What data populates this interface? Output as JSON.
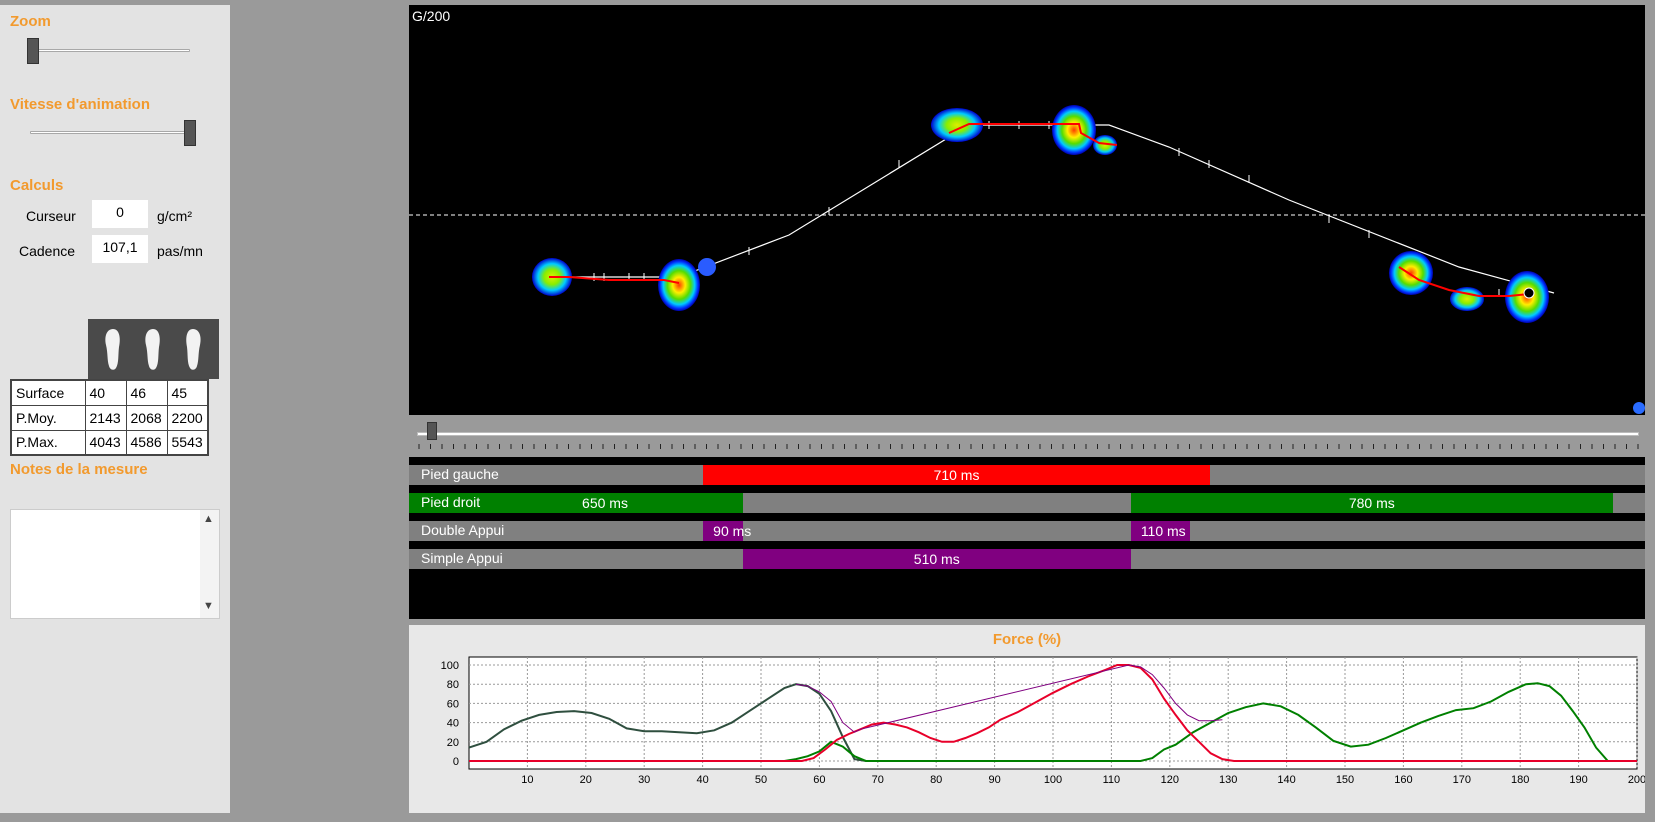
{
  "left_panel": {
    "zoom_title": "Zoom",
    "speed_title": "Vitesse d'animation",
    "calc_title": "Calculs",
    "cursor_label": "Curseur",
    "cursor_value": "0",
    "cursor_unit": "g/cm²",
    "cadence_label": "Cadence",
    "cadence_value": "107,1",
    "cadence_unit": "pas/mn",
    "stats": {
      "rows": [
        {
          "label": "Surface",
          "values": [
            "40",
            "46",
            "45"
          ]
        },
        {
          "label": "P.Moy.",
          "values": [
            "2143",
            "2068",
            "2200"
          ]
        },
        {
          "label": "P.Max.",
          "values": [
            "4043",
            "4586",
            "5543"
          ]
        }
      ]
    },
    "notes_title": "Notes de la mesure",
    "notes_text": ""
  },
  "pressure_view": {
    "label": "G/200"
  },
  "phases": {
    "rows": [
      {
        "label": "Pied gauche",
        "segments": [
          {
            "text": "710 ms",
            "color": "#ff0000",
            "start": 0.238,
            "end": 0.648
          }
        ]
      },
      {
        "label": "Pied droit",
        "segments": [
          {
            "text": "650 ms",
            "color": "#008000",
            "start": 0.0,
            "end": 0.27,
            "text_offset": 0.14
          },
          {
            "text": "780 ms",
            "color": "#008000",
            "start": 0.584,
            "end": 0.974
          }
        ]
      },
      {
        "label": "Double Appui",
        "segments": [
          {
            "text": "90 ms",
            "color": "#800080",
            "start": 0.238,
            "end": 0.27
          },
          {
            "text": "110 ms",
            "color": "#800080",
            "start": 0.584,
            "end": 0.632
          }
        ]
      },
      {
        "label": "Simple Appui",
        "segments": [
          {
            "text": "510 ms",
            "color": "#800080",
            "start": 0.27,
            "end": 0.584
          }
        ]
      }
    ]
  },
  "chart_data": {
    "type": "line",
    "title": "Force (%)",
    "xlim": [
      0,
      200
    ],
    "ylim": [
      0,
      100
    ],
    "x_ticks": [
      10,
      20,
      30,
      40,
      50,
      60,
      70,
      80,
      90,
      100,
      110,
      120,
      130,
      140,
      150,
      160,
      170,
      180,
      190,
      200
    ],
    "y_ticks": [
      0,
      20,
      40,
      60,
      80,
      100
    ],
    "grid": true,
    "series": [
      {
        "color": "#2f4f3f",
        "points": [
          [
            0,
            14
          ],
          [
            3,
            20
          ],
          [
            6,
            33
          ],
          [
            9,
            42
          ],
          [
            12,
            48
          ],
          [
            15,
            51
          ],
          [
            18,
            52
          ],
          [
            21,
            50
          ],
          [
            24,
            44
          ],
          [
            27,
            34
          ],
          [
            30,
            31
          ],
          [
            33,
            31
          ],
          [
            36,
            30
          ],
          [
            39,
            29
          ],
          [
            42,
            32
          ],
          [
            45,
            40
          ],
          [
            48,
            52
          ],
          [
            51,
            64
          ],
          [
            54,
            76
          ],
          [
            56,
            80
          ],
          [
            58,
            78
          ],
          [
            60,
            70
          ],
          [
            62,
            52
          ],
          [
            64,
            25
          ],
          [
            66,
            2
          ],
          [
            68,
            0
          ]
        ]
      },
      {
        "color": "#008000",
        "points": [
          [
            0,
            0
          ],
          [
            54,
            0
          ],
          [
            56,
            2
          ],
          [
            58,
            5
          ],
          [
            60,
            10
          ],
          [
            62,
            20
          ],
          [
            64,
            15
          ],
          [
            66,
            5
          ],
          [
            68,
            0
          ],
          [
            115,
            0
          ],
          [
            117,
            3
          ],
          [
            119,
            12
          ],
          [
            121,
            17
          ],
          [
            124,
            30
          ],
          [
            127,
            40
          ],
          [
            130,
            50
          ],
          [
            133,
            56
          ],
          [
            136,
            60
          ],
          [
            139,
            57
          ],
          [
            142,
            48
          ],
          [
            145,
            35
          ],
          [
            148,
            21
          ],
          [
            151,
            15
          ],
          [
            154,
            17
          ],
          [
            157,
            24
          ],
          [
            160,
            32
          ],
          [
            163,
            40
          ],
          [
            166,
            47
          ],
          [
            169,
            53
          ],
          [
            172,
            55
          ],
          [
            175,
            62
          ],
          [
            178,
            72
          ],
          [
            181,
            80
          ],
          [
            183,
            81
          ],
          [
            185,
            78
          ],
          [
            187,
            68
          ],
          [
            189,
            52
          ],
          [
            191,
            35
          ],
          [
            193,
            14
          ],
          [
            195,
            0
          ],
          [
            200,
            0
          ]
        ]
      },
      {
        "color": "#e8002a",
        "points": [
          [
            0,
            0
          ],
          [
            57,
            0
          ],
          [
            59,
            3
          ],
          [
            61,
            12
          ],
          [
            63,
            22
          ],
          [
            65,
            28
          ],
          [
            67,
            33
          ],
          [
            69,
            38
          ],
          [
            71,
            40
          ],
          [
            73,
            38
          ],
          [
            75,
            35
          ],
          [
            77,
            30
          ],
          [
            79,
            24
          ],
          [
            81,
            20
          ],
          [
            83,
            20
          ],
          [
            85,
            24
          ],
          [
            87,
            29
          ],
          [
            89,
            35
          ],
          [
            91,
            43
          ],
          [
            94,
            51
          ],
          [
            97,
            61
          ],
          [
            100,
            71
          ],
          [
            103,
            80
          ],
          [
            106,
            88
          ],
          [
            109,
            95
          ],
          [
            111,
            100
          ],
          [
            113,
            100
          ],
          [
            115,
            97
          ],
          [
            117,
            85
          ],
          [
            119,
            65
          ],
          [
            121,
            48
          ],
          [
            123,
            32
          ],
          [
            125,
            20
          ],
          [
            127,
            8
          ],
          [
            129,
            2
          ],
          [
            131,
            0
          ],
          [
            200,
            0
          ]
        ]
      },
      {
        "color": "#800080",
        "points": [
          [
            56,
            80
          ],
          [
            58,
            78
          ],
          [
            60,
            72
          ],
          [
            62,
            62
          ],
          [
            64,
            40
          ],
          [
            66,
            30
          ],
          [
            67,
            33
          ],
          [
            113,
            100
          ],
          [
            115,
            98
          ],
          [
            117,
            90
          ],
          [
            119,
            76
          ],
          [
            121,
            60
          ],
          [
            123,
            48
          ],
          [
            125,
            42
          ],
          [
            127,
            42
          ],
          [
            129,
            43
          ]
        ]
      }
    ]
  }
}
